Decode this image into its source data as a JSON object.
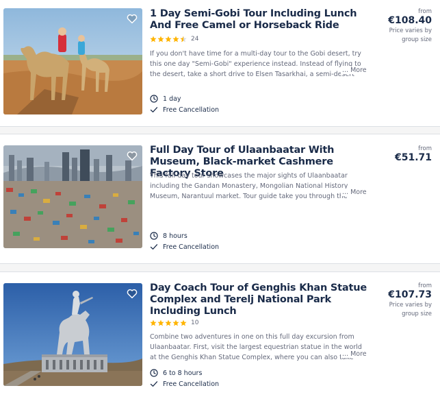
{
  "listings": [
    {
      "title": "1 Day Semi-Gobi Tour Including Lunch And Free Camel or Horseback Ride",
      "rating_stars": 4.5,
      "review_count": "24",
      "description": "If you don't have time for a multi-day tour to the Gobi desert, try this one day \"Semi-Gobi\" experience instead. Instead of flying to the desert, take a short drive to Elsen Tasarkhai, a semi-desert region",
      "more_label": "... More",
      "duration": "1 day",
      "cancellation": "Free Cancellation",
      "price_from_label": "from",
      "price": "€108.40",
      "price_note": "Price varies by group size",
      "image_icon": "camel-ride-photo"
    },
    {
      "title": "Full Day Tour of Ulaanbaatar With Museum, Black-market Cashmere Factory Store",
      "description": "This full-day tour showcases the major sights of Ulaanbaatar including the Gandan Monastery, Mongolian National History Museum, Narantuul market. Tour guide take you through the",
      "more_label": "... More",
      "duration": "8 hours",
      "cancellation": "Free Cancellation",
      "price_from_label": "from",
      "price": "€51.71",
      "image_icon": "city-skyline-photo"
    },
    {
      "title": "Day Coach Tour of Genghis Khan Statue Complex and Terelj National Park Including Lunch",
      "rating_stars": 5,
      "review_count": "10",
      "description": "Combine two adventures in one on this full day excursion from Ulaanbaatar. First, visit the largest equestrian statue in the world at the Genghis Khan Statue Complex, where you can also take",
      "more_label": "... More",
      "duration": "6 to 8 hours",
      "cancellation": "Free Cancellation",
      "price_from_label": "from",
      "price": "€107.73",
      "price_note": "Price varies by group size",
      "image_icon": "equestrian-statue-photo"
    }
  ],
  "colors": {
    "text_dark": "#1a2b49",
    "text_muted": "#63687a",
    "star": "#ffb400",
    "separator": "#dcdfe4"
  }
}
